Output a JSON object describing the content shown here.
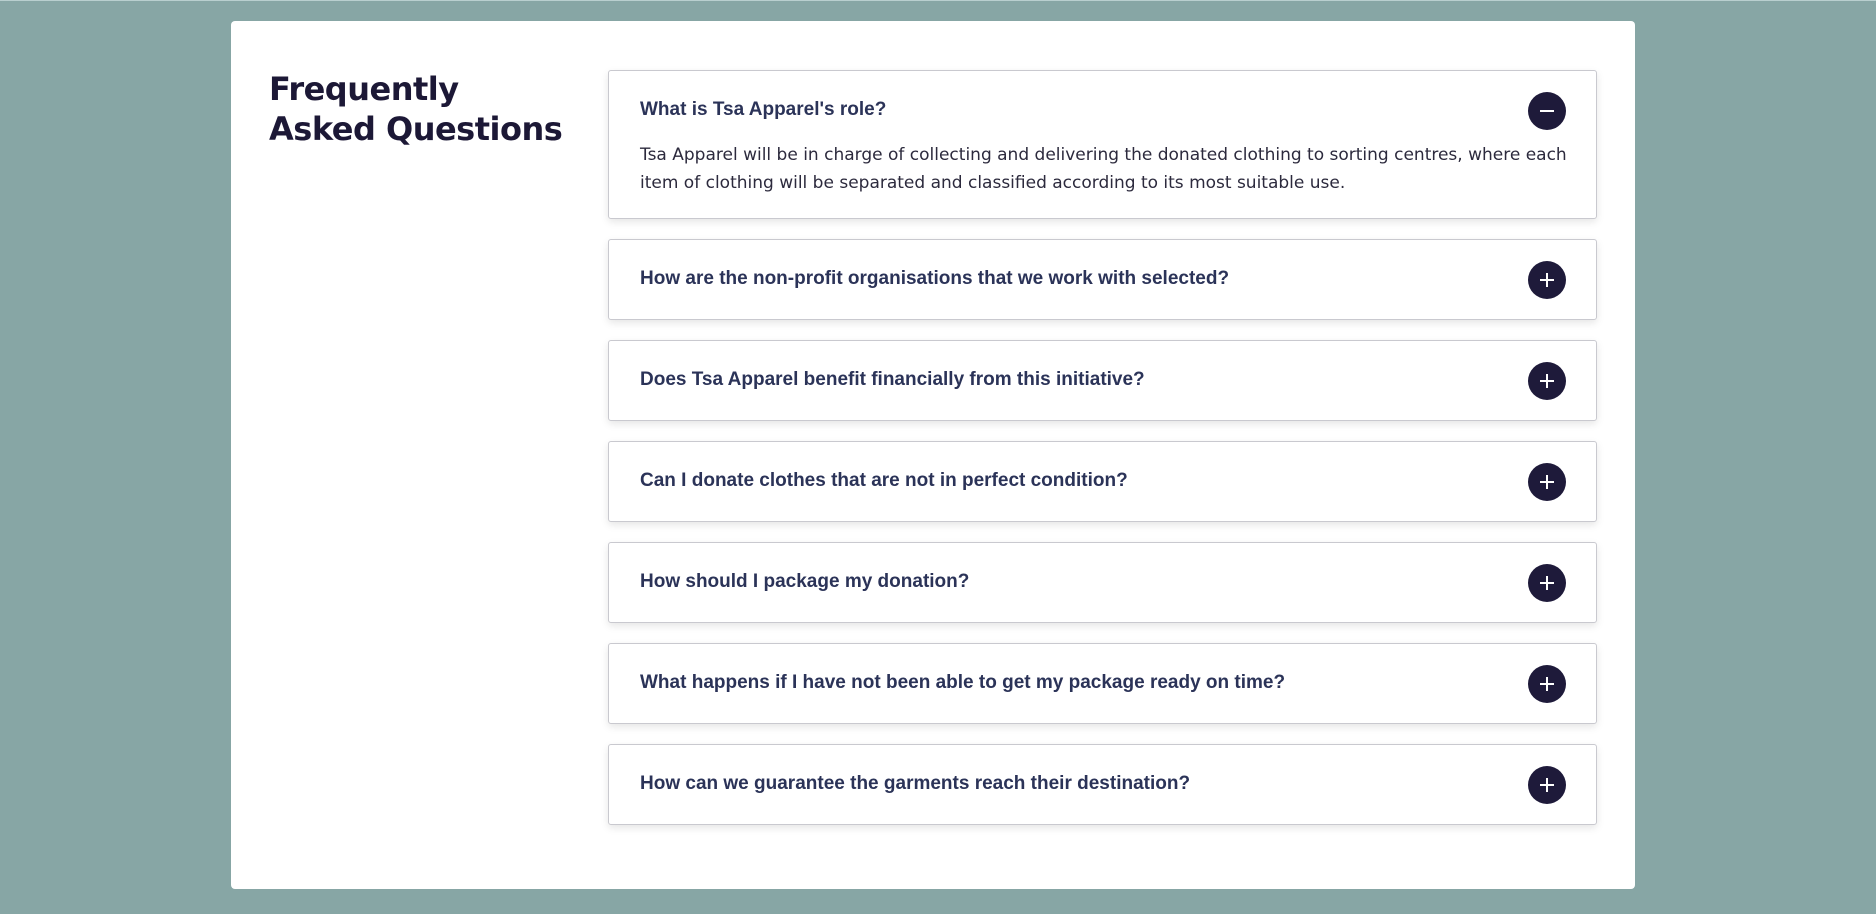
{
  "page": {
    "title": "Frequently Asked Questions"
  },
  "colors": {
    "background": "#87a6a5",
    "card": "#ffffff",
    "title": "#1c1836",
    "question": "#2b3358",
    "toggle": "#1e1a3a"
  },
  "faq": {
    "items": [
      {
        "question": "What is Tsa Apparel's role?",
        "answer": "Tsa Apparel will be in charge of collecting and delivering the donated clothing to sorting centres, where each item of clothing will be separated and classified according to its most suitable use.",
        "expanded": true,
        "icon": "minus-icon"
      },
      {
        "question": "How are the non-profit organisations that we work with selected?",
        "expanded": false,
        "icon": "plus-icon"
      },
      {
        "question": "Does Tsa Apparel benefit financially from this initiative?",
        "expanded": false,
        "icon": "plus-icon"
      },
      {
        "question": "Can I donate clothes that are not in perfect condition?",
        "expanded": false,
        "icon": "plus-icon"
      },
      {
        "question": "How should I package my donation?",
        "expanded": false,
        "icon": "plus-icon"
      },
      {
        "question": "What happens if I have not been able to get my package ready on time?",
        "expanded": false,
        "icon": "plus-icon"
      },
      {
        "question": "How can we guarantee the garments reach their destination?",
        "expanded": false,
        "icon": "plus-icon"
      }
    ]
  }
}
